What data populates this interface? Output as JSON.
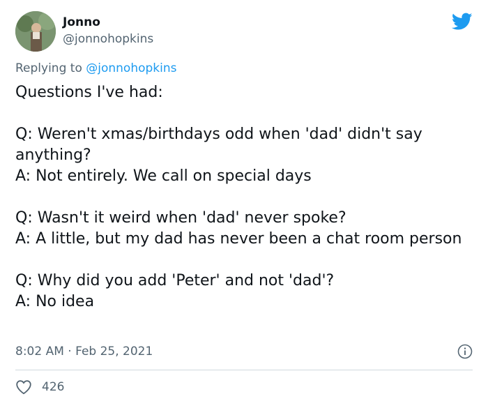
{
  "user": {
    "name": "Jonno",
    "handle": "@jonnohopkins"
  },
  "reply": {
    "prefix": "Replying to ",
    "handle": "@jonnohopkins"
  },
  "tweet": {
    "lines": [
      "Questions I've had:",
      "Q: Weren't xmas/birthdays odd when 'dad' didn't say anything?",
      "A: Not entirely. We call on special days",
      "Q: Wasn't it weird when 'dad' never spoke?",
      "A: A little, but my dad has never been a chat room person",
      "Q: Why did you add 'Peter' and not 'dad'?",
      "A: No idea"
    ]
  },
  "meta": {
    "time": "8:02 AM",
    "separator": " · ",
    "date": "Feb 25, 2021"
  },
  "likes": {
    "count": "426"
  },
  "colors": {
    "brand": "#1d9bf0",
    "text": "#0f1419",
    "muted": "#536471",
    "divider": "#cfd9de"
  },
  "icons": {
    "logo": "twitter-bird-icon",
    "info": "info-icon",
    "like": "heart-icon"
  }
}
